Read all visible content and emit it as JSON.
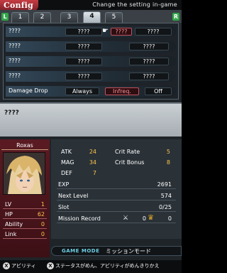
{
  "header": {
    "title": "Config",
    "message": "Change the setting in-game"
  },
  "tabstrip": {
    "left_shoulder": "L",
    "right_shoulder": "R",
    "tabs": [
      "1",
      "2",
      "3",
      "4",
      "5"
    ],
    "active_tab": "4"
  },
  "settings": {
    "rows": [
      {
        "label": "????",
        "options": [
          "????",
          "????",
          "????"
        ],
        "selected": 1
      },
      {
        "label": "????",
        "options": [
          "????",
          "????"
        ]
      },
      {
        "label": "????",
        "options": [
          "????",
          "????"
        ]
      },
      {
        "label": "????",
        "options": [
          "????",
          "????"
        ]
      },
      {
        "label": "Damage Drop",
        "options": [
          "Always",
          "Infreq.",
          "Off"
        ],
        "selected": 1
      }
    ]
  },
  "description": {
    "text": "????"
  },
  "character": {
    "name": "Roxas",
    "lv_label": "LV",
    "lv": "1",
    "hp_label": "HP",
    "hp": "62",
    "ability_label": "Ability",
    "ability": "0",
    "link_label": "Link",
    "link": "0"
  },
  "stats": {
    "atk_label": "ATK",
    "atk": "24",
    "crit_rate_label": "Crit Rate",
    "crit_rate": "5",
    "mag_label": "MAG",
    "mag": "34",
    "crit_bonus_label": "Crit Bonus",
    "crit_bonus": "8",
    "def_label": "DEF",
    "def": "7",
    "exp_label": "EXP",
    "exp": "2691",
    "next_level_label": "Next Level",
    "next_level": "574",
    "slot_label": "Slot",
    "slot": "0/25",
    "mission_record_label": "Mission Record",
    "mission_record_a": "0",
    "mission_record_b": "0"
  },
  "mode": {
    "label": "GAME MODE",
    "value": "ミッションモード"
  },
  "footer": {
    "left_button": "X",
    "left_label": "アビリティ",
    "right_button": "X",
    "right_label": "ステータスがめん、アビリティがめんきりかえ"
  },
  "colors": {
    "accent": "#c63c43",
    "value_yellow": "#ffc44a",
    "mode_cyan": "#6fd0e6",
    "shoulder_green": "#33a64a"
  },
  "icons": {
    "cursor": "pointing-hand-icon",
    "sword": "sword-icon",
    "crown": "crown-icon"
  }
}
